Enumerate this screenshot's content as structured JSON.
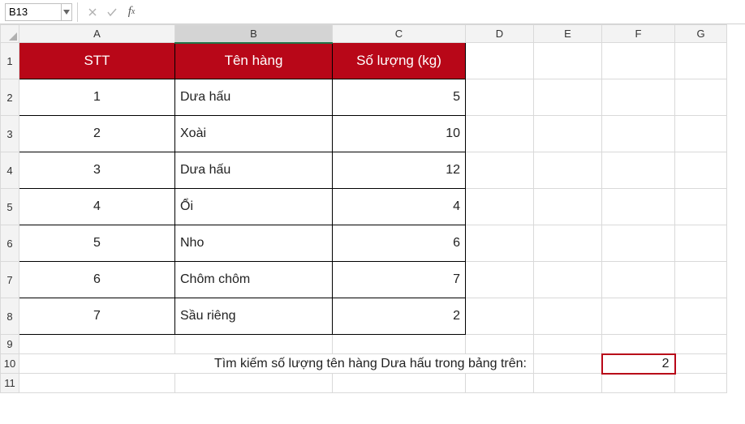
{
  "nameBox": "B13",
  "formulaValue": "",
  "columns": [
    "A",
    "B",
    "C",
    "D",
    "E",
    "F",
    "G"
  ],
  "colWidths": {
    "A": 192,
    "B": 194,
    "C": 164,
    "D": 84,
    "E": 84,
    "F": 90,
    "G": 64
  },
  "rowNumbers": [
    1,
    2,
    3,
    4,
    5,
    6,
    7,
    8,
    9,
    10,
    11
  ],
  "header": {
    "stt": "STT",
    "name": "Tên hàng",
    "qty": "Số lượng (kg)"
  },
  "rows": [
    {
      "stt": "1",
      "name": "Dưa hấu",
      "qty": "5"
    },
    {
      "stt": "2",
      "name": "Xoài",
      "qty": "10"
    },
    {
      "stt": "3",
      "name": "Dưa hấu",
      "qty": "12"
    },
    {
      "stt": "4",
      "name": "Ổi",
      "qty": "4"
    },
    {
      "stt": "5",
      "name": "Nho",
      "qty": "6"
    },
    {
      "stt": "6",
      "name": "Chôm chôm",
      "qty": "7"
    },
    {
      "stt": "7",
      "name": "Sầu riêng",
      "qty": "2"
    }
  ],
  "searchLabel": "Tìm kiếm số lượng tên hàng Dưa hấu trong bảng trên:",
  "searchResult": "2"
}
